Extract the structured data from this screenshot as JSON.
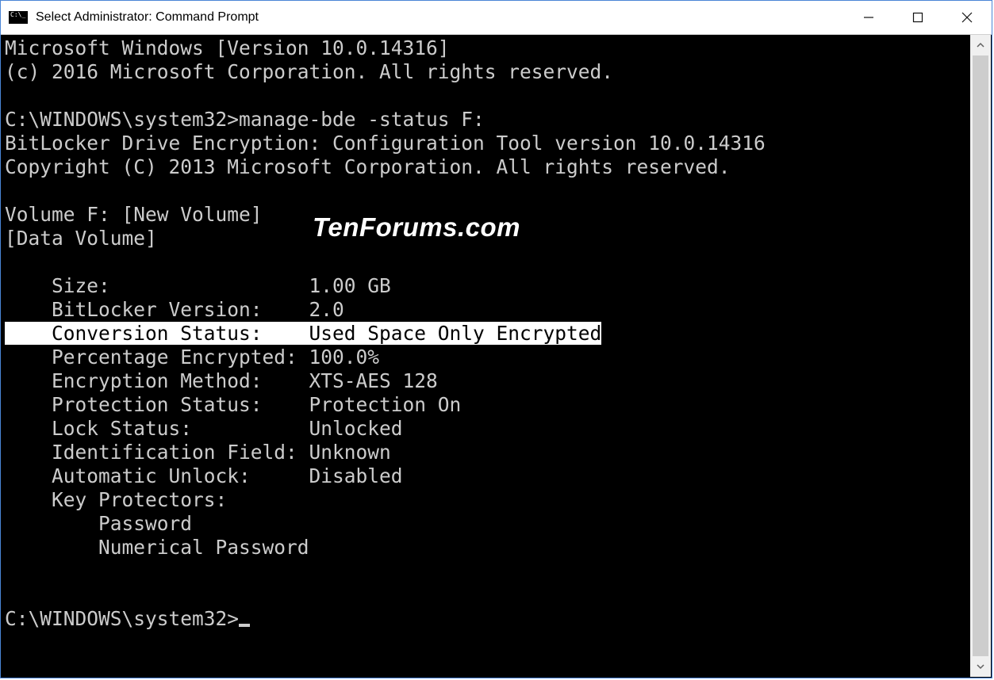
{
  "window": {
    "title": "Select Administrator: Command Prompt"
  },
  "terminal": {
    "line_version": "Microsoft Windows [Version 10.0.14316]",
    "line_copyright": "(c) 2016 Microsoft Corporation. All rights reserved.",
    "prompt1": "C:\\WINDOWS\\system32>",
    "command1": "manage-bde -status F:",
    "tool_line": "BitLocker Drive Encryption: Configuration Tool version 10.0.14316",
    "tool_copyright": "Copyright (C) 2013 Microsoft Corporation. All rights reserved.",
    "volume_line": "Volume F: [New Volume]",
    "volume_type": "[Data Volume]",
    "fields": {
      "size_label": "    Size:                 ",
      "size_value": "1.00 GB",
      "blver_label": "    BitLocker Version:    ",
      "blver_value": "2.0",
      "conv_label": "    Conversion Status:    ",
      "conv_value": "Used Space Only Encrypted",
      "pct_label": "    Percentage Encrypted: ",
      "pct_value": "100.0%",
      "encm_label": "    Encryption Method:    ",
      "encm_value": "XTS-AES 128",
      "prot_label": "    Protection Status:    ",
      "prot_value": "Protection On",
      "lock_label": "    Lock Status:          ",
      "lock_value": "Unlocked",
      "idf_label": "    Identification Field: ",
      "idf_value": "Unknown",
      "auto_label": "    Automatic Unlock:     ",
      "auto_value": "Disabled",
      "kp_label": "    Key Protectors:",
      "kp1": "        Password",
      "kp2": "        Numerical Password"
    },
    "prompt2": "C:\\WINDOWS\\system32>"
  },
  "watermark": "TenForums.com"
}
